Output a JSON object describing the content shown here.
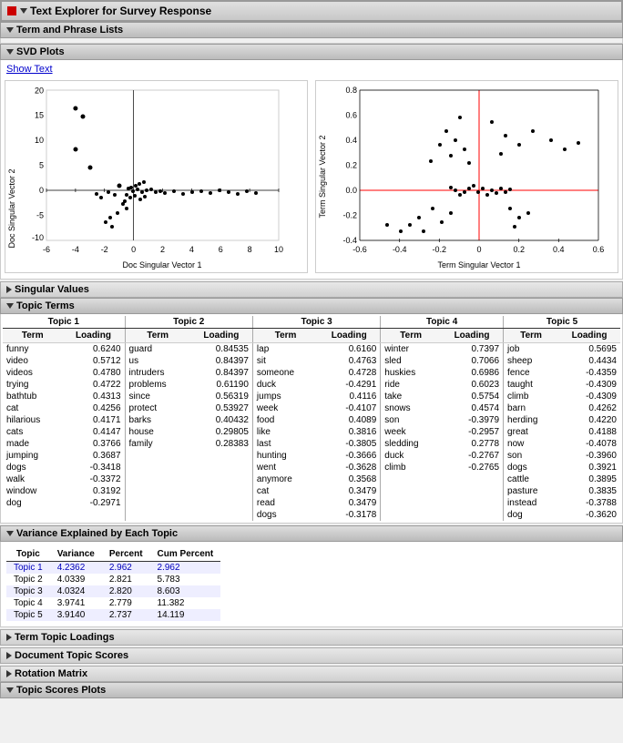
{
  "title": "Text Explorer for Survey Response",
  "sections": {
    "termPhraseLists": "Term and Phrase Lists",
    "svdPlots": "SVD Plots",
    "showText": "Show Text",
    "singularValues": "Singular Values",
    "topicTerms": "Topic Terms",
    "varianceExplained": "Variance Explained by Each Topic",
    "termTopicLoadings": "Term Topic Loadings",
    "documentTopicScores": "Document Topic Scores",
    "rotationMatrix": "Rotation Matrix",
    "topicScoresPlots": "Topic Scores Plots"
  },
  "plots": {
    "left": {
      "xLabel": "Doc Singular Vector 1",
      "yLabel": "Doc Singular Vector 2",
      "xRange": [
        -6,
        10
      ],
      "yRange": [
        -10,
        20
      ]
    },
    "right": {
      "xLabel": "Term Singular Vector 1",
      "yLabel": "Term Singular Vector 2",
      "xRange": [
        -0.6,
        0.6
      ],
      "yRange": [
        -0.4,
        0.8
      ]
    }
  },
  "topicTerms": {
    "topics": [
      "Topic 1",
      "Topic 2",
      "Topic 3",
      "Topic 4",
      "Topic 5"
    ],
    "columns": [
      "Term",
      "Loading",
      "Term",
      "Loading",
      "Term",
      "Loading",
      "Term",
      "Loading",
      "Term",
      "Loading"
    ],
    "rows": [
      [
        "funny",
        "0.6240",
        "guard",
        "0.84535",
        "lap",
        "0.6160",
        "winter",
        "0.7397",
        "job",
        "0.5695"
      ],
      [
        "video",
        "0.5712",
        "us",
        "0.84397",
        "sit",
        "0.4763",
        "sled",
        "0.7066",
        "sheep",
        "0.4434"
      ],
      [
        "videos",
        "0.4780",
        "intruders",
        "0.84397",
        "someone",
        "0.4728",
        "huskies",
        "0.6986",
        "fence",
        "-0.4359"
      ],
      [
        "trying",
        "0.4722",
        "problems",
        "0.61190",
        "duck",
        "-0.4291",
        "ride",
        "0.6023",
        "taught",
        "-0.4309"
      ],
      [
        "bathtub",
        "0.4313",
        "since",
        "0.56319",
        "jumps",
        "0.4116",
        "take",
        "0.5754",
        "climb",
        "-0.4309"
      ],
      [
        "cat",
        "0.4256",
        "protect",
        "0.53927",
        "week",
        "-0.4107",
        "snows",
        "0.4574",
        "barn",
        "0.4262"
      ],
      [
        "hilarious",
        "0.4171",
        "barks",
        "0.40432",
        "food",
        "0.4089",
        "son",
        "-0.3979",
        "herding",
        "0.4220"
      ],
      [
        "cats",
        "0.4147",
        "house",
        "0.29805",
        "like",
        "0.3816",
        "week",
        "-0.2957",
        "great",
        "0.4188"
      ],
      [
        "made",
        "0.3766",
        "family",
        "0.28383",
        "last",
        "-0.3805",
        "sledding",
        "0.2778",
        "now",
        "-0.4078"
      ],
      [
        "jumping",
        "0.3687",
        "",
        "",
        "hunting",
        "-0.3666",
        "duck",
        "-0.2767",
        "son",
        "-0.3960"
      ],
      [
        "dogs",
        "-0.3418",
        "",
        "",
        "went",
        "-0.3628",
        "climb",
        "-0.2765",
        "dogs",
        "0.3921"
      ],
      [
        "walk",
        "-0.3372",
        "",
        "",
        "anymore",
        "0.3568",
        "",
        "",
        "cattle",
        "0.3895"
      ],
      [
        "window",
        "0.3192",
        "",
        "",
        "cat",
        "0.3479",
        "",
        "",
        "pasture",
        "0.3835"
      ],
      [
        "dog",
        "-0.2971",
        "",
        "",
        "read",
        "0.3479",
        "",
        "",
        "instead",
        "-0.3788"
      ],
      [
        "",
        "",
        "",
        "",
        "dogs",
        "-0.3178",
        "",
        "",
        "dog",
        "-0.3620"
      ]
    ]
  },
  "variance": {
    "headers": [
      "Topic",
      "Variance",
      "Percent",
      "Cum Percent"
    ],
    "rows": [
      [
        "Topic 1",
        "4.2362",
        "2.962",
        "2.962"
      ],
      [
        "Topic 2",
        "4.0339",
        "2.821",
        "5.783"
      ],
      [
        "Topic 3",
        "4.0324",
        "2.820",
        "8.603"
      ],
      [
        "Topic 4",
        "3.9741",
        "2.779",
        "11.382"
      ],
      [
        "Topic 5",
        "3.9140",
        "2.737",
        "14.119"
      ]
    ]
  }
}
